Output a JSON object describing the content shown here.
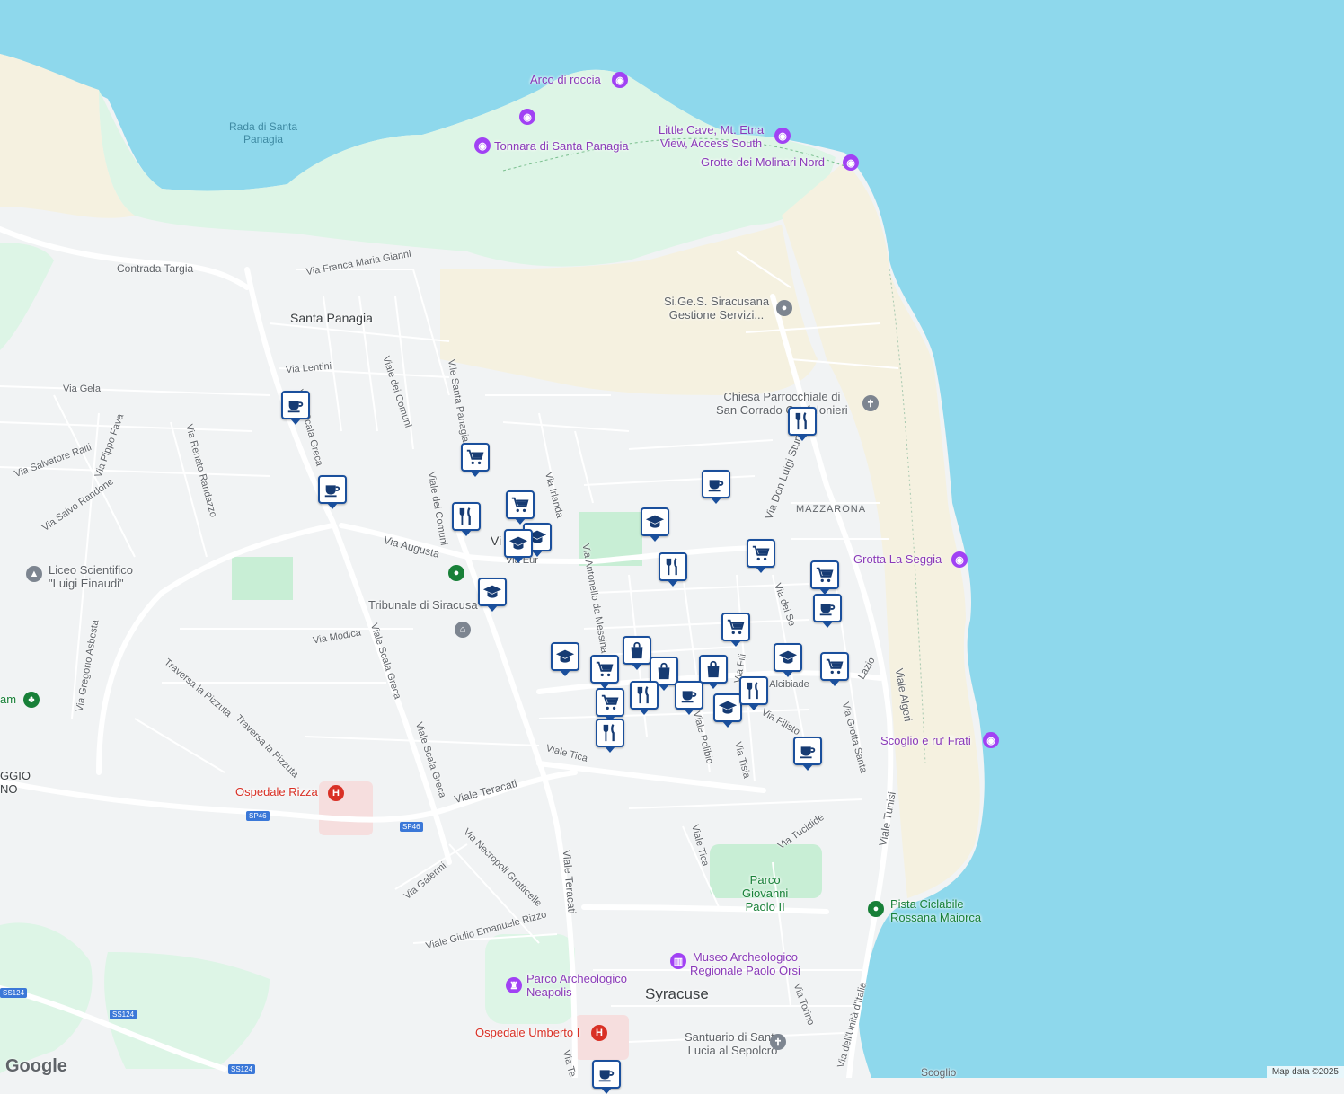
{
  "colors": {
    "water": "#8ed8ec",
    "land": "#f1f3f4",
    "park": "#ddf5e6",
    "sand": "#f5f1e0",
    "pin_border": "#1a4f9c",
    "poi_purple": "#8a3ab9",
    "hospital": "#d93025"
  },
  "water_labels": {
    "rada": "Rada di Santa\nPanagia"
  },
  "places": {
    "santa_panagia": "Santa Panagia",
    "syracuse": "Syracuse",
    "mazzarona": "MAZZARONA",
    "parco_gp2": "Parco\nGiovanni\nPaolo II",
    "grottasanta_frag": "GGIO\nNO"
  },
  "pois": {
    "arco": "Arco di roccia",
    "tonnara": "Tonnara di Santa Panagia",
    "little_cave": "Little Cave, Mt. Etna\nView, Access South",
    "grotte_molinari": "Grotte dei Molinari Nord",
    "sigess": "Si.Ge.S. Siracusana\nGestione Servizi...",
    "chiesa": "Chiesa Parrocchiale di\nSan Corrado Confalonieri",
    "grotta_seggia": "Grotta La Seggia",
    "scoglio": "Scoglio e ru' Frati",
    "liceo": "Liceo Scientifico\n\"Luigi Einaudi\"",
    "tribunale": "Tribunale di Siracusa",
    "ospedale_rizza": "Ospedale Rizza",
    "pista": "Pista Ciclabile\nRossana Maiorca",
    "museo": "Museo Archeologico\nRegionale Paolo Orsi",
    "parco_neapolis": "Parco Archeologico\nNeapolis",
    "ospedale_umberto": "Ospedale Umberto I",
    "santuario": "Santuario di Santa\nLucia al Sepolcro",
    "am_frag": "am"
  },
  "roads": {
    "contrada_targia": "Contrada Targia",
    "franca": "Via Franca Maria Gianni",
    "lentini": "Via Lentini",
    "gela": "Via Gela",
    "scala_greca_n": "Viale Scala Greca",
    "dei_comuni_a": "Viale dei Comuni",
    "dei_comuni_b": "Viale dei Comuni",
    "santa_panagia_v": "V.le Santa Panagia",
    "pippo_fava": "Via Pippo Fava",
    "salvatore_raiti": "Via Salvatore Raiti",
    "salvo_randone": "Via Salvo Randone",
    "renato_randazzo": "Via Renato Randazzo",
    "augusta": "Via Augusta",
    "eur": "Via Eur",
    "irlanda": "Via Irlanda",
    "antonello": "Via Antonello da Messina",
    "modica": "Via Modica",
    "gregorio": "Via Gregorio Asbesta",
    "scala_greca_s1": "Viale Scala Greca",
    "scala_greca_s2": "Viale Scala Greca",
    "pizzuta1": "Traversa la Pizzuta",
    "pizzuta2": "Traversa la Pizzuta",
    "tica1": "Viale Tica",
    "tica2": "Viale Tica",
    "teracati1": "Viale Teracati",
    "teracati2": "Viale Teracati",
    "necropoli": "Via Necropoli Grotticelle",
    "galermi": "Via Galermi",
    "giulio": "Viale Giulio Emanuele Rizzo",
    "polibio": "Viale Polibio",
    "tisia": "Via Tisia",
    "filisto": "Via Filisto",
    "alcibiade": "Via Alcibiade",
    "tucidide": "Via Tucidide",
    "grotta_santa": "Via Grotta Santa",
    "algeri": "Viale Algeri",
    "tunisi": "Viale Tunisi",
    "italia": "Via dell'Unità d'Italia",
    "torino": "Via Torino",
    "sturzo": "Via Don Luigi Sturzo",
    "dei_sep": "Via dei Se",
    "lazio": "Lazio",
    "fili": "Via Fili",
    "scogliera": "Scoglio",
    "via_te": "Via Te",
    "sp46a": "SP46",
    "sp46b": "SP46",
    "ss124a": "SS124",
    "ss124b": "SS124",
    "ss124c": "SS124",
    "vi_frag": "Vi"
  },
  "pins": [
    {
      "type": "cafe-icon"
    },
    {
      "type": "cafe-icon"
    },
    {
      "type": "cart-icon"
    },
    {
      "type": "restaurant-icon"
    },
    {
      "type": "cart-icon"
    },
    {
      "type": "school-icon"
    },
    {
      "type": "school-icon"
    },
    {
      "type": "school-icon"
    },
    {
      "type": "restaurant-icon"
    },
    {
      "type": "cafe-icon"
    },
    {
      "type": "school-icon"
    },
    {
      "type": "cart-icon"
    },
    {
      "type": "restaurant-icon"
    },
    {
      "type": "cart-icon"
    },
    {
      "type": "cafe-icon"
    },
    {
      "type": "cart-icon"
    },
    {
      "type": "school-icon"
    },
    {
      "type": "bag-icon"
    },
    {
      "type": "cart-icon"
    },
    {
      "type": "bag-icon"
    },
    {
      "type": "bag-icon"
    },
    {
      "type": "cart-icon"
    },
    {
      "type": "restaurant-icon"
    },
    {
      "type": "cafe-icon"
    },
    {
      "type": "school-icon"
    },
    {
      "type": "restaurant-icon"
    },
    {
      "type": "school-icon"
    },
    {
      "type": "cart-icon"
    },
    {
      "type": "cafe-icon"
    },
    {
      "type": "restaurant-icon"
    },
    {
      "type": "cafe-icon"
    }
  ],
  "footer": {
    "google": "Google",
    "attribution": "Map data ©2025"
  }
}
